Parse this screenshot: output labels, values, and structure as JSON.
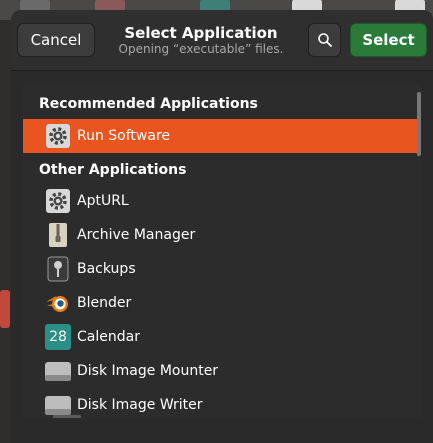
{
  "dialog": {
    "title": "Select Application",
    "subtitle": "Opening “executable” files.",
    "cancel_label": "Cancel",
    "select_label": "Select"
  },
  "sections": {
    "recommended": "Recommended Applications",
    "other": "Other Applications"
  },
  "recommended_apps": [
    {
      "label": "Run Software",
      "icon": "gear-icon",
      "selected": true
    }
  ],
  "other_apps": [
    {
      "label": "AptURL",
      "icon": "gear-icon"
    },
    {
      "label": "Archive Manager",
      "icon": "zip-archive-icon"
    },
    {
      "label": "Backups",
      "icon": "safe-icon"
    },
    {
      "label": "Blender",
      "icon": "blender-icon"
    },
    {
      "label": "Calendar",
      "icon": "calendar-icon",
      "icon_text": "28"
    },
    {
      "label": "Disk Image Mounter",
      "icon": "disk-drive-icon"
    },
    {
      "label": "Disk Image Writer",
      "icon": "disk-drive-icon"
    }
  ],
  "colors": {
    "selection": "#e9541f",
    "select_button": "#2a7a3a",
    "dialog_bg": "#2a2a2a"
  }
}
